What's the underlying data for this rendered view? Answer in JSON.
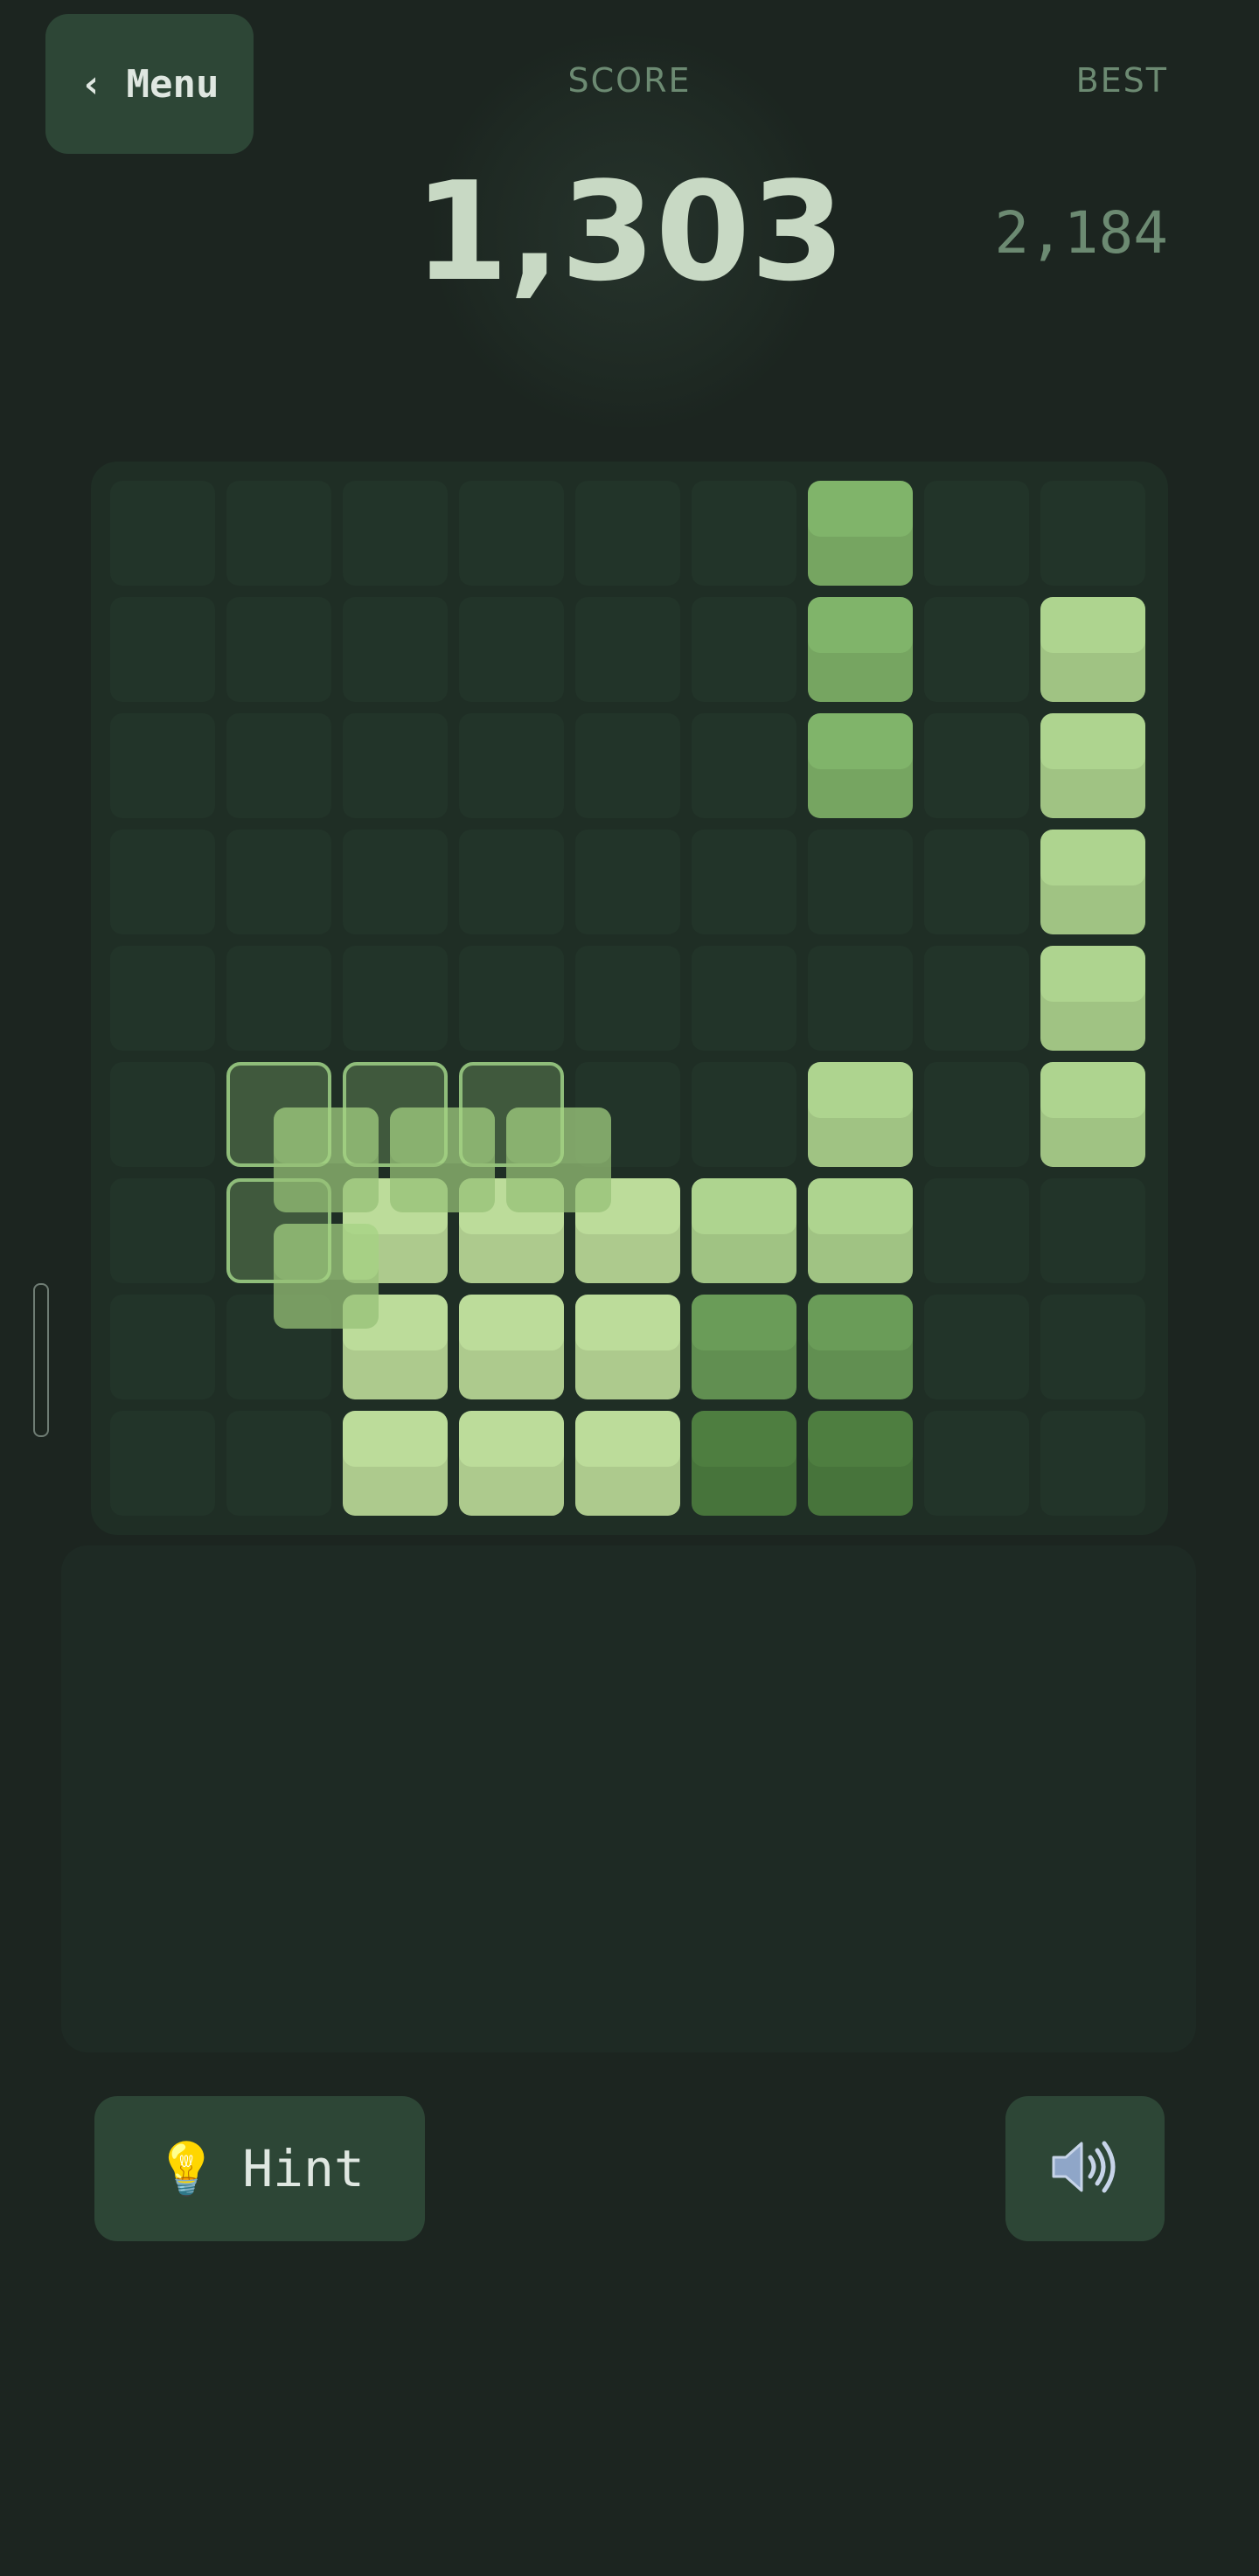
{
  "header": {
    "menu_label": "‹ Menu",
    "score_label": "SCORE",
    "score_value": "1,303",
    "best_label": "BEST",
    "best_value": "2,184"
  },
  "board": {
    "rows": 9,
    "cols": 9,
    "cells": [
      [
        0,
        0,
        0,
        0,
        0,
        0,
        2,
        0,
        0
      ],
      [
        0,
        0,
        0,
        0,
        0,
        0,
        2,
        0,
        3
      ],
      [
        0,
        0,
        0,
        0,
        0,
        0,
        2,
        0,
        3
      ],
      [
        0,
        0,
        0,
        0,
        0,
        0,
        0,
        0,
        3
      ],
      [
        0,
        0,
        0,
        0,
        0,
        0,
        0,
        0,
        3
      ],
      [
        0,
        0,
        0,
        0,
        0,
        0,
        3,
        0,
        3
      ],
      [
        0,
        0,
        4,
        4,
        4,
        3,
        3,
        0,
        0
      ],
      [
        0,
        0,
        4,
        4,
        4,
        5,
        5,
        0,
        0
      ],
      [
        0,
        0,
        4,
        4,
        4,
        6,
        6,
        0,
        0
      ]
    ],
    "palette": {
      "0": "#223429",
      "2": "#80b46a",
      "3": "#aed48f",
      "4": "#bcdc9a",
      "5": "#6a9c58",
      "6": "#4e7e40"
    },
    "ghost_cells": [
      [
        5,
        1
      ],
      [
        5,
        2
      ],
      [
        5,
        3
      ],
      [
        6,
        1
      ]
    ]
  },
  "controls": {
    "hint_icon": "💡",
    "hint_label": "Hint",
    "sound_icon": "speaker-icon"
  },
  "colors": {
    "background": "#1c2520",
    "button": "#2d4636",
    "accent_light": "#bcdc9a"
  }
}
